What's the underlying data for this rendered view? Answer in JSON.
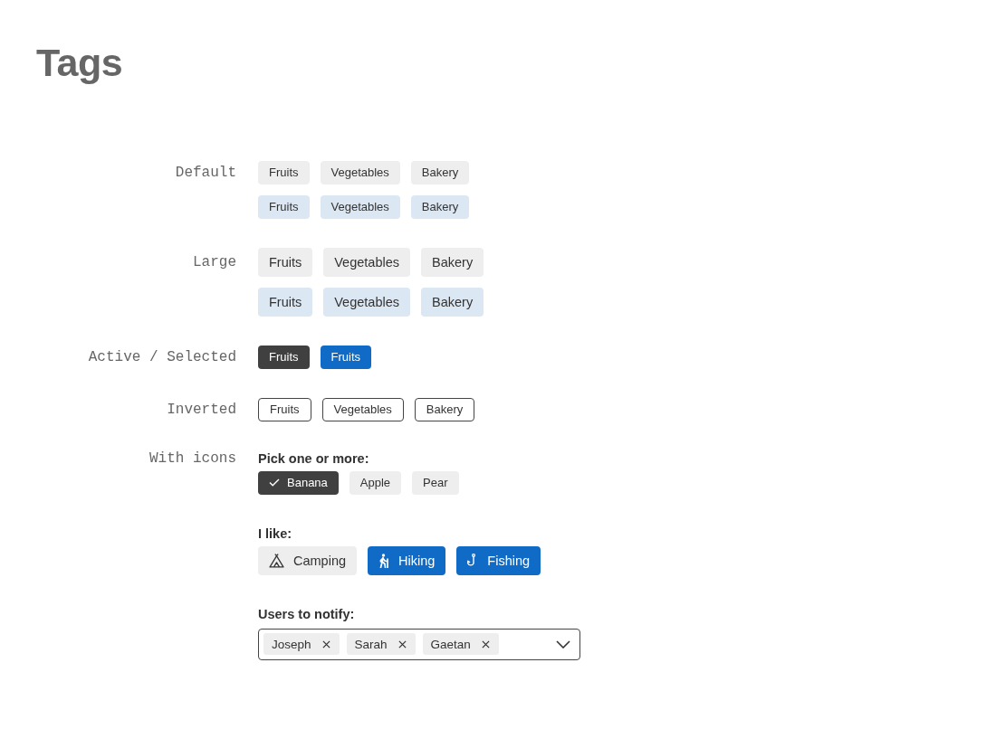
{
  "title": "Tags",
  "sections": [
    {
      "label": "Default",
      "kind": "small",
      "rows": [
        {
          "kind": "neutral",
          "tags": [
            "Fruits",
            "Vegetables",
            "Bakery"
          ]
        },
        {
          "kind": "accent",
          "tags": [
            "Fruits",
            "Vegetables",
            "Bakery"
          ]
        }
      ]
    },
    {
      "label": "Large",
      "kind": "large",
      "rows": [
        {
          "kind": "neutral",
          "tags": [
            "Fruits",
            "Vegetables",
            "Bakery"
          ]
        },
        {
          "kind": "accent",
          "tags": [
            "Fruits",
            "Vegetables",
            "Bakery"
          ]
        }
      ]
    },
    {
      "label": "Active / Selected",
      "kind": "states",
      "tags": [
        {
          "text": "Fruits",
          "kind": "active"
        },
        {
          "text": "Fruits",
          "kind": "selected"
        }
      ]
    },
    {
      "label": "Inverted",
      "kind": "outline",
      "tags": [
        "Fruits",
        "Vegetables",
        "Bakery"
      ]
    },
    {
      "label": "With icons",
      "kind": "groups",
      "groups": [
        {
          "kind": "check",
          "title": "Pick one or more:",
          "tags": [
            {
              "text": "Banana",
              "selected": true
            },
            {
              "text": "Apple",
              "selected": false
            },
            {
              "text": "Pear",
              "selected": false
            }
          ]
        },
        {
          "kind": "icon",
          "title": "I like:",
          "tags": [
            {
              "text": "Camping",
              "kind": "tent",
              "selected": false
            },
            {
              "text": "Hiking",
              "kind": "hiker",
              "selected": true
            },
            {
              "text": "Fishing",
              "kind": "hook",
              "selected": true
            }
          ]
        },
        {
          "kind": "multiselect",
          "title": "Users to notify:",
          "chips": [
            "Joseph",
            "Sarah",
            "Gaetan"
          ]
        }
      ]
    }
  ]
}
